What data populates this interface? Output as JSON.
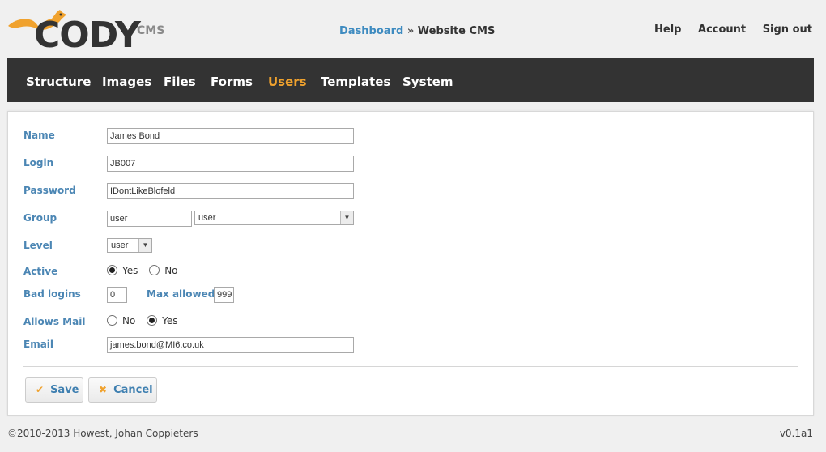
{
  "header": {
    "logo_text": "CODY",
    "logo_suffix": "CMS",
    "breadcrumb": {
      "link": "Dashboard",
      "separator": "»",
      "current": "Website CMS"
    },
    "links": [
      "Help",
      "Account",
      "Sign out"
    ]
  },
  "nav": {
    "items": [
      "Structure",
      "Images",
      "Files",
      "Forms",
      "Users",
      "Templates",
      "System"
    ],
    "active": "Users"
  },
  "form": {
    "name": {
      "label": "Name",
      "value": "James Bond"
    },
    "login": {
      "label": "Login",
      "value": "JB007"
    },
    "password": {
      "label": "Password",
      "value": "IDontLikeBlofeld"
    },
    "group": {
      "label": "Group",
      "value": "user",
      "select_value": "user"
    },
    "level": {
      "label": "Level",
      "select_value": "user"
    },
    "active": {
      "label": "Active",
      "options": [
        "Yes",
        "No"
      ],
      "selected": "Yes"
    },
    "bad_logins": {
      "label": "Bad logins",
      "value": "0",
      "max_label": "Max allowed",
      "max_value": "999"
    },
    "allows_mail": {
      "label": "Allows Mail",
      "options": [
        "No",
        "Yes"
      ],
      "selected": "Yes"
    },
    "email": {
      "label": "Email",
      "value": "james.bond@MI6.co.uk"
    }
  },
  "buttons": {
    "save": "Save",
    "cancel": "Cancel"
  },
  "footer": {
    "copyright": "©2010-2013 Howest, Johan Coppieters",
    "version": "v0.1a1"
  },
  "colors": {
    "accent": "#f0a22e",
    "link": "#3e8bc0",
    "nav_bg": "#333333",
    "label": "#4b86b4"
  }
}
